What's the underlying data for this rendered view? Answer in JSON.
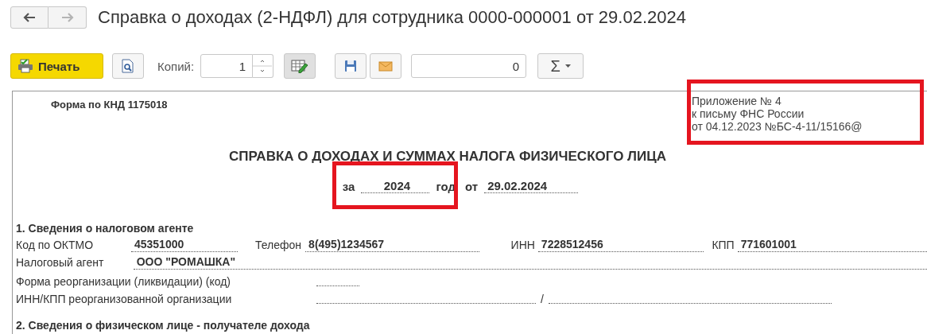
{
  "nav": [
    {
      "kind": "back",
      "disabled": false
    },
    {
      "kind": "forward",
      "disabled": true
    }
  ],
  "title": "Справка о доходах (2-НДФЛ) для сотрудника 0000-000001 от 29.02.2024",
  "toolbar": {
    "print_label": "Печать",
    "copies_label": "Копий:",
    "copies_value": "1",
    "sum_value": "0",
    "sum_symbol": "Σ"
  },
  "document": {
    "form_code": "Форма по КНД 1175018",
    "appendix": [
      "Приложение № 4",
      "к письму ФНС России",
      "от 04.12.2023 №БС-4-11/15166@"
    ],
    "heading": "СПРАВКА О ДОХОДАХ И СУММАХ НАЛОГА ФИЗИЧЕСКОГО ЛИЦА",
    "period": {
      "prefix": "за",
      "year": "2024",
      "suffix": "год",
      "from_label": "от",
      "date": "29.02.2024"
    },
    "section_1": {
      "title": "1. Сведения о налоговом агенте",
      "oktmo_label": "Код по ОКТМО",
      "oktmo": "45351000",
      "phone_label": "Телефон",
      "phone": "8(495)1234567",
      "inn_label": "ИНН",
      "inn": "7228512456",
      "kpp_label": "КПП",
      "kpp": "771601001",
      "agent_label": "Налоговый агент",
      "agent": "ООО \"РОМАШКА\"",
      "reorg_form_label": "Форма реорганизации (ликвидации)  (код)",
      "reorg_inn_label": "ИНН/КПП  реорганизованной организации",
      "reorg_separator": "/"
    },
    "section_2": {
      "title": "2. Сведения о физическом лице - получателе дохода"
    }
  }
}
